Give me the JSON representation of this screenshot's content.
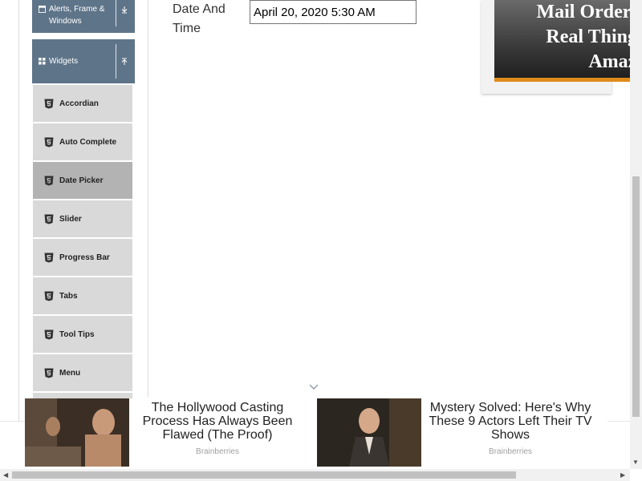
{
  "sidebar": {
    "groups": [
      {
        "label_line1": "Alerts, Frame &",
        "label_line2": "Windows",
        "icon": "window-icon",
        "toggle_icon": "expand-down-icon"
      },
      {
        "label": "Widgets",
        "icon": "grid-icon",
        "toggle_icon": "collapse-up-icon"
      }
    ],
    "items": [
      {
        "label": "Accordian",
        "icon": "html5-icon"
      },
      {
        "label": "Auto Complete",
        "icon": "html5-icon"
      },
      {
        "label": "Date Picker",
        "icon": "html5-icon",
        "active": true
      },
      {
        "label": "Slider",
        "icon": "html5-icon"
      },
      {
        "label": "Progress Bar",
        "icon": "html5-icon"
      },
      {
        "label": "Tabs",
        "icon": "html5-icon"
      },
      {
        "label": "Tool Tips",
        "icon": "html5-icon"
      },
      {
        "label": "Menu",
        "icon": "html5-icon"
      }
    ]
  },
  "form": {
    "date_time_label_line1": "Date And",
    "date_time_label_line2": "Time",
    "date_time_value": "April 20, 2020 5:30 AM"
  },
  "ad_top": {
    "text_line1": "Mail Order ’",
    "text_line2": "Real Thing,",
    "text_line3": "Amazi"
  },
  "ads_bottom": [
    {
      "title": "The Hollywood Casting Process Has Always Been Flawed (The Proof)",
      "source": "Brainberries"
    },
    {
      "title": "Mystery Solved: Here's Why These 9 Actors Left Their TV Shows",
      "source": "Brainberries"
    }
  ],
  "colors": {
    "group_header_bg": "#5e7489",
    "menu_item_bg": "#d9d9d9",
    "menu_item_active_bg": "#b3b3b3",
    "ad_accent": "#e08a1a"
  }
}
